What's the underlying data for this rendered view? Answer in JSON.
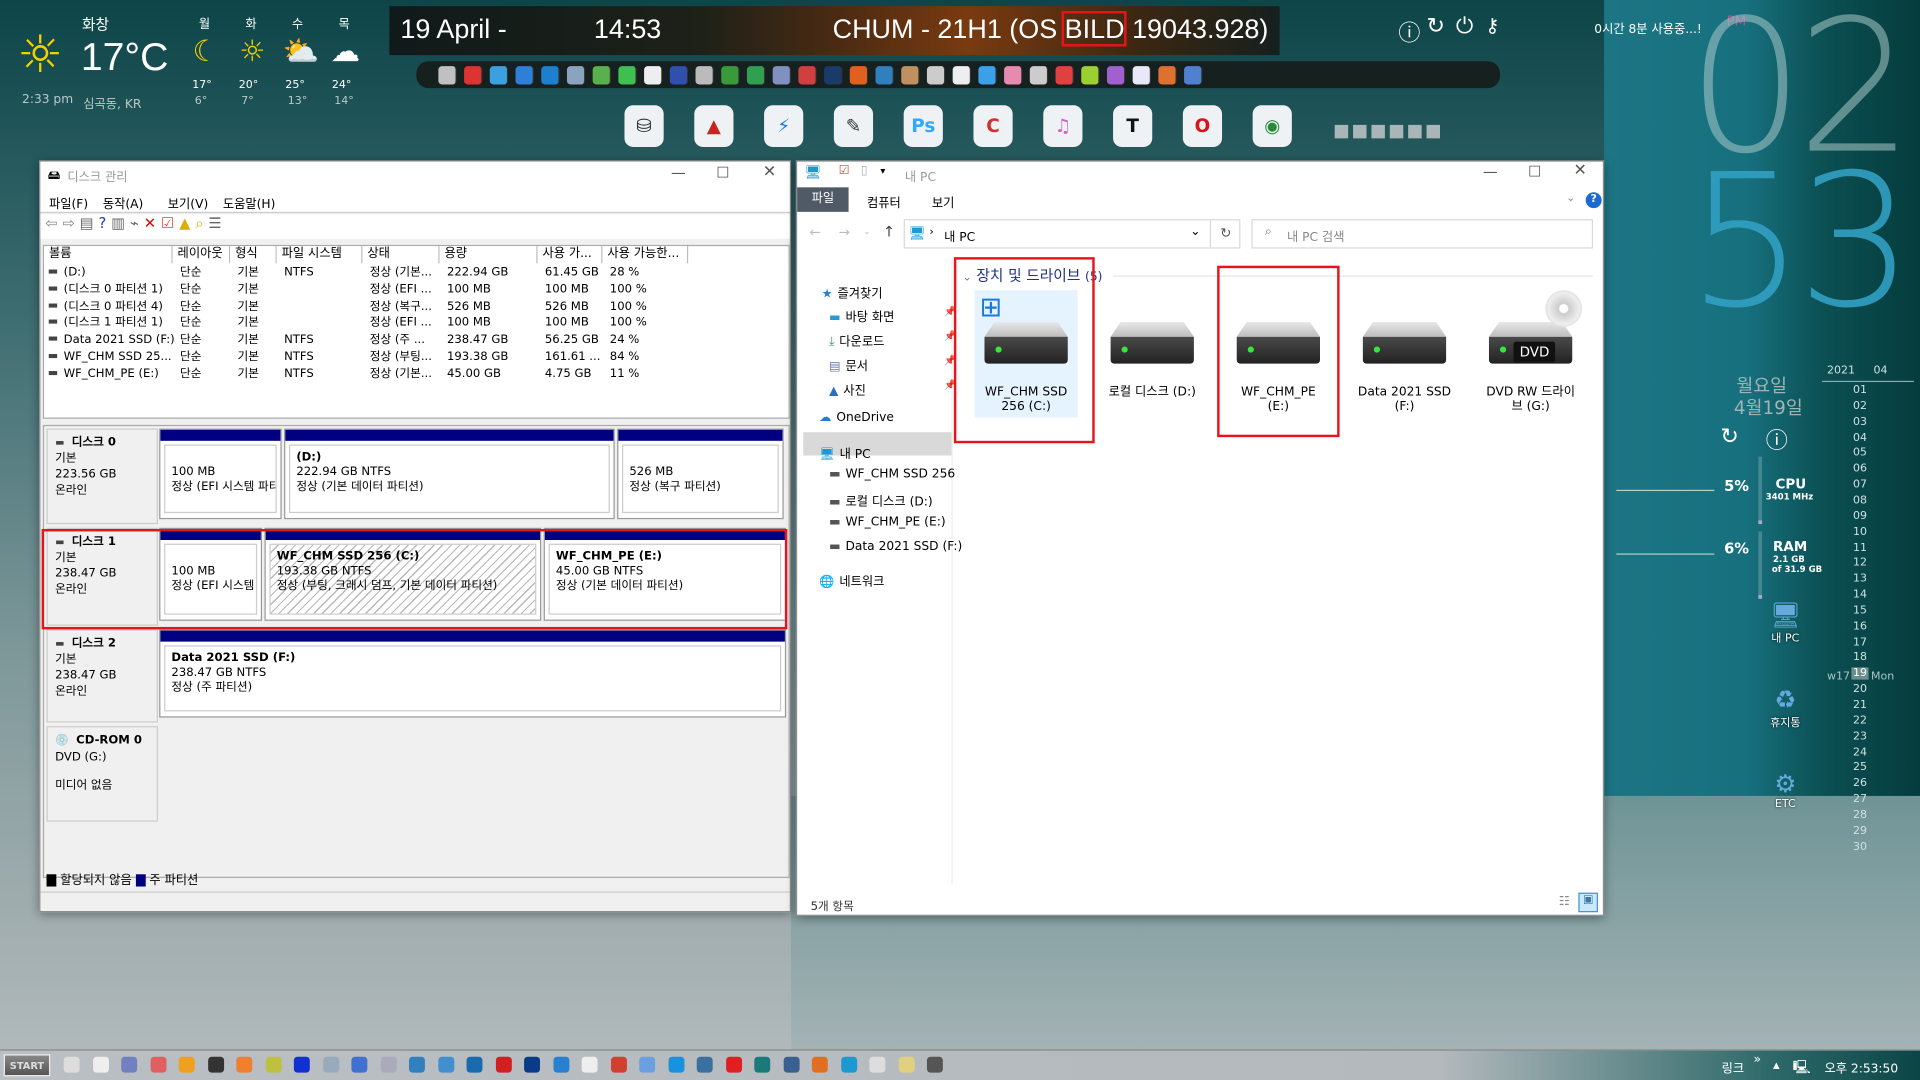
{
  "weather": {
    "condition": "화창",
    "temp": "17°C",
    "time": "2:33 pm",
    "location": "심곡동, KR",
    "forecast": [
      {
        "day": "월",
        "icon": "moon",
        "high": "17°",
        "low": "6°"
      },
      {
        "day": "화",
        "icon": "sun",
        "high": "20°",
        "low": "7°"
      },
      {
        "day": "수",
        "icon": "partly-cloudy",
        "high": "25°",
        "low": "13°"
      },
      {
        "day": "목",
        "icon": "cloud",
        "high": "24°",
        "low": "14°"
      }
    ]
  },
  "banner": {
    "date": "19 April -",
    "time": "14:53",
    "title_prefix": "CHUM - 21H1 (OS ",
    "title_highlight": "BILD",
    "title_suffix": " 19043.928)"
  },
  "icon_strip": [
    "#c0c0c0",
    "#d33",
    "#3aa0e0",
    "#2d7fd8",
    "#1c7fd0",
    "#8aa4c0",
    "#5ab04a",
    "#3ec050",
    "#eee",
    "#3050b0",
    "#bbb",
    "#3a9a3a",
    "#30a050",
    "#8090c0",
    "#d04040",
    "#1a3a6a",
    "#e06020",
    "#3080c0",
    "#c09060",
    "#ccc",
    "#eee",
    "#3aa0e8",
    "#e88ab0",
    "#ccc",
    "#e04040",
    "#9bd030",
    "#a060d0",
    "#e8e8f8",
    "#e07030",
    "#5080d0"
  ],
  "dock": [
    {
      "name": "disk-utility",
      "glyph": "⛁",
      "color": "#222"
    },
    {
      "name": "chart-app",
      "glyph": "▲",
      "color": "#c22"
    },
    {
      "name": "bolt-app",
      "glyph": "⚡",
      "color": "#1a78d8"
    },
    {
      "name": "broom-app",
      "glyph": "✎",
      "color": "#333"
    },
    {
      "name": "photoshop",
      "glyph": "Ps",
      "color": "#31a8ff"
    },
    {
      "name": "ccleaner",
      "glyph": "C",
      "color": "#d03030"
    },
    {
      "name": "itunes",
      "glyph": "♫",
      "color": "#d060c0"
    },
    {
      "name": "typora",
      "glyph": "T",
      "color": "#111"
    },
    {
      "name": "opera",
      "glyph": "O",
      "color": "#e0101a"
    },
    {
      "name": "chrome",
      "glyph": "◉",
      "color": "#2a8a3a"
    }
  ],
  "sysinfo": {
    "uptime": "0시간 8분 사용중...!",
    "ampm": "PM",
    "hour": "02",
    "minute": "53",
    "weekday": "월요일",
    "date": "4월19일",
    "cpu_label": "CPU",
    "cpu_pct": "5%",
    "cpu_freq": "3401 MHz",
    "cpu_value": 5,
    "ram_label": "RAM",
    "ram_pct": "6%",
    "ram_used": "2.1 GB",
    "ram_total": "of 31.9 GB",
    "ram_value": 6
  },
  "calendar": {
    "year": "2021",
    "month": "04",
    "week": "w17",
    "today": "19",
    "today_day": "Mon",
    "days": [
      "01",
      "02",
      "03",
      "04",
      "05",
      "06",
      "07",
      "08",
      "09",
      "10",
      "11",
      "12",
      "13",
      "14",
      "15",
      "16",
      "17",
      "18",
      "19",
      "20",
      "21",
      "22",
      "23",
      "24",
      "25",
      "26",
      "27",
      "28",
      "29",
      "30"
    ]
  },
  "desktop_icons": [
    {
      "label": "내 PC"
    },
    {
      "label": "휴지통"
    },
    {
      "label": "ETC"
    }
  ],
  "diskmgmt": {
    "title": "디스크 관리",
    "menu": [
      "파일(F)",
      "동작(A)",
      "보기(V)",
      "도움말(H)"
    ],
    "columns": [
      "볼륨",
      "레이아웃",
      "형식",
      "파일 시스템",
      "상태",
      "용량",
      "사용 가...",
      "사용 가능한..."
    ],
    "rows": [
      [
        "(D:)",
        "단순",
        "기본",
        "NTFS",
        "정상 (기본...",
        "222.94 GB",
        "61.45 GB",
        "28 %"
      ],
      [
        "(디스크 0 파티션 1)",
        "단순",
        "기본",
        "",
        "정상 (EFI ...",
        "100 MB",
        "100 MB",
        "100 %"
      ],
      [
        "(디스크 0 파티션 4)",
        "단순",
        "기본",
        "",
        "정상 (복구...",
        "526 MB",
        "526 MB",
        "100 %"
      ],
      [
        "(디스크 1 파티션 1)",
        "단순",
        "기본",
        "",
        "정상 (EFI ...",
        "100 MB",
        "100 MB",
        "100 %"
      ],
      [
        "Data 2021 SSD (F:)",
        "단순",
        "기본",
        "NTFS",
        "정상 (주 ...",
        "238.47 GB",
        "56.25 GB",
        "24 %"
      ],
      [
        "WF_CHM SSD 25...",
        "단순",
        "기본",
        "NTFS",
        "정상 (부팅...",
        "193.38 GB",
        "161.61 ...",
        "84 %"
      ],
      [
        "WF_CHM_PE (E:)",
        "단순",
        "기본",
        "NTFS",
        "정상 (기본...",
        "45.00 GB",
        "4.75 GB",
        "11 %"
      ]
    ],
    "disks": [
      {
        "name": "디스크 0",
        "type": "기본",
        "size": "223.56 GB",
        "status": "온라인",
        "parts": [
          {
            "title": "",
            "l1": "100 MB",
            "l2": "정상 (EFI 시스템 파티"
          },
          {
            "title": "(D:)",
            "l1": "222.94 GB NTFS",
            "l2": "정상 (기본 데이터 파티션)"
          },
          {
            "title": "",
            "l1": "526 MB",
            "l2": "정상 (복구 파티션)"
          }
        ]
      },
      {
        "name": "디스크 1",
        "type": "기본",
        "size": "238.47 GB",
        "status": "온라인",
        "parts": [
          {
            "title": "",
            "l1": "100 MB",
            "l2": "정상 (EFI 시스템"
          },
          {
            "title": "WF_CHM SSD 256  (C:)",
            "l1": "193.38 GB NTFS",
            "l2": "정상 (부팅, 크래시 덤프, 기본 데이터 파티션)"
          },
          {
            "title": "WF_CHM_PE  (E:)",
            "l1": "45.00 GB NTFS",
            "l2": "정상 (기본 데이터 파티션)"
          }
        ]
      },
      {
        "name": "디스크 2",
        "type": "기본",
        "size": "238.47 GB",
        "status": "온라인",
        "parts": [
          {
            "title": "Data 2021 SSD  (F:)",
            "l1": "238.47 GB NTFS",
            "l2": "정상 (주 파티션)"
          }
        ]
      }
    ],
    "cdrom": {
      "name": "CD-ROM 0",
      "drive": "DVD (G:)",
      "status": "미디어 없음"
    },
    "legend": [
      {
        "label": "할당되지 않음",
        "color": "#000000"
      },
      {
        "label": "주 파티션",
        "color": "#000080"
      }
    ]
  },
  "explorer": {
    "title": "내 PC",
    "tabs": [
      "파일",
      "컴퓨터",
      "보기"
    ],
    "address": "내 PC",
    "search_placeholder": "내 PC 검색",
    "nav": [
      {
        "label": "즐겨찾기",
        "icon": "star"
      },
      {
        "label": "바탕 화면",
        "icon": "desktop"
      },
      {
        "label": "다운로드",
        "icon": "download"
      },
      {
        "label": "문서",
        "icon": "document"
      },
      {
        "label": "사진",
        "icon": "picture"
      },
      {
        "label": "OneDrive",
        "icon": "cloud"
      },
      {
        "label": "내 PC",
        "icon": "computer"
      },
      {
        "label": "WF_CHM SSD 256",
        "icon": "drive"
      },
      {
        "label": "로컬 디스크 (D:)",
        "icon": "drive"
      },
      {
        "label": "WF_CHM_PE (E:)",
        "icon": "drive"
      },
      {
        "label": "Data 2021 SSD (F:)",
        "icon": "drive"
      },
      {
        "label": "네트워크",
        "icon": "network"
      }
    ],
    "group_title": "장치 및 드라이브",
    "group_count": "(5)",
    "drives": [
      {
        "label": "WF_CHM SSD 256 (C:)"
      },
      {
        "label": "로컬 디스크 (D:)"
      },
      {
        "label": "WF_CHM_PE (E:)"
      },
      {
        "label": "Data 2021 SSD (F:)"
      },
      {
        "label": "DVD RW 드라이브 (G:)",
        "badge": "DVD"
      }
    ],
    "status": "5개 항목"
  },
  "taskbar": {
    "start": "START",
    "links": "링크",
    "chevron": "»",
    "clock": "오후 2:53:50",
    "icons": [
      "#ddd",
      "#eee",
      "#7080c0",
      "#e06060",
      "#f0a020",
      "#333",
      "#f08030",
      "#c0c040",
      "#1030d0",
      "#9ab",
      "#4070d0",
      "#aab",
      "#3080c0",
      "#4090d0",
      "#1a6ab0",
      "#d02020",
      "#0a3a8a",
      "#2a80d0",
      "#eee",
      "#d04030",
      "#6aa0e0",
      "#1a90e0",
      "#3a70a0",
      "#e02020",
      "#1a7a7a",
      "#3a6090",
      "#e07020",
      "#1a9ad0",
      "#ddd",
      "#e0d080",
      "#555"
    ]
  }
}
